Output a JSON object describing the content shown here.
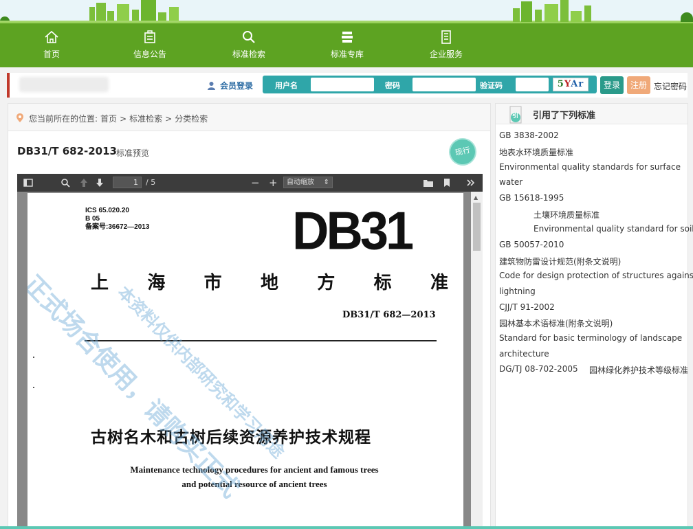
{
  "nav": {
    "items": [
      {
        "label": "首页",
        "icon": "home-icon"
      },
      {
        "label": "信息公告",
        "icon": "notice-icon"
      },
      {
        "label": "标准检索",
        "icon": "search-icon"
      },
      {
        "label": "标准专库",
        "icon": "library-icon"
      },
      {
        "label": "企业服务",
        "icon": "enterprise-icon"
      }
    ]
  },
  "login": {
    "member_label": "会员登录",
    "username_label": "用户名",
    "password_label": "密码",
    "captcha_label": "验证码",
    "captcha_chars": [
      "5",
      "Y",
      "A",
      "r"
    ],
    "login_button": "登录",
    "register_button": "注册",
    "forgot_link": "忘记密码"
  },
  "breadcrumb": {
    "prefix": "您当前所在的位置:",
    "items": [
      "首页",
      "标准检索",
      "分类检索"
    ],
    "separator": ">"
  },
  "document": {
    "code": "DB31/T 682-2013",
    "subtitle": "标准预览",
    "status": "现行"
  },
  "viewer": {
    "page_current": "1",
    "page_total": "/ 5",
    "zoom": "自动缩放",
    "zoom_out": "−",
    "zoom_in": "+"
  },
  "page": {
    "ics_lines": [
      "ICS 65.020.20",
      "B  05",
      "备案号:36672—2013"
    ],
    "logo": "DB31",
    "org_chars": [
      "上",
      "海",
      "市",
      "地",
      "方",
      "标",
      "准"
    ],
    "std_number": "DB31/T 682—2013",
    "title_cn": "古树名木和古树后续资源养护技术规程",
    "title_en_lines": [
      "Maintenance technology procedures for ancient and famous trees",
      "and potential resource of ancient trees"
    ],
    "watermark_1": "正式场合使用，请购买正式",
    "watermark_2": "本资料仅供内部研究和学习用途"
  },
  "sidebar": {
    "title": "引用了下列标准",
    "badge": "引",
    "refs": [
      "GB 3838-2002",
      "地表水环境质量标准",
      "Environmental quality standards for surface",
      "water",
      "GB 15618-1995",
      "土壤环境质量标准",
      "Environmental quality standard for soils",
      "GB 50057-2010",
      "建筑物防雷设计规范(附条文说明)",
      "Code for design protection of structures against",
      "lightning",
      "CJJ/T 91-2002",
      "园林基本术语标准(附条文说明)",
      "Standard for basic terminology of landscape",
      "architecture",
      "DG/TJ 08-702-2005",
      "园林绿化养护技术等级标准"
    ]
  },
  "colors": {
    "nav_green": "#5da322",
    "teal": "#2fa6a9",
    "register_orange": "#f0a979",
    "status_teal": "#5cc8b4"
  }
}
